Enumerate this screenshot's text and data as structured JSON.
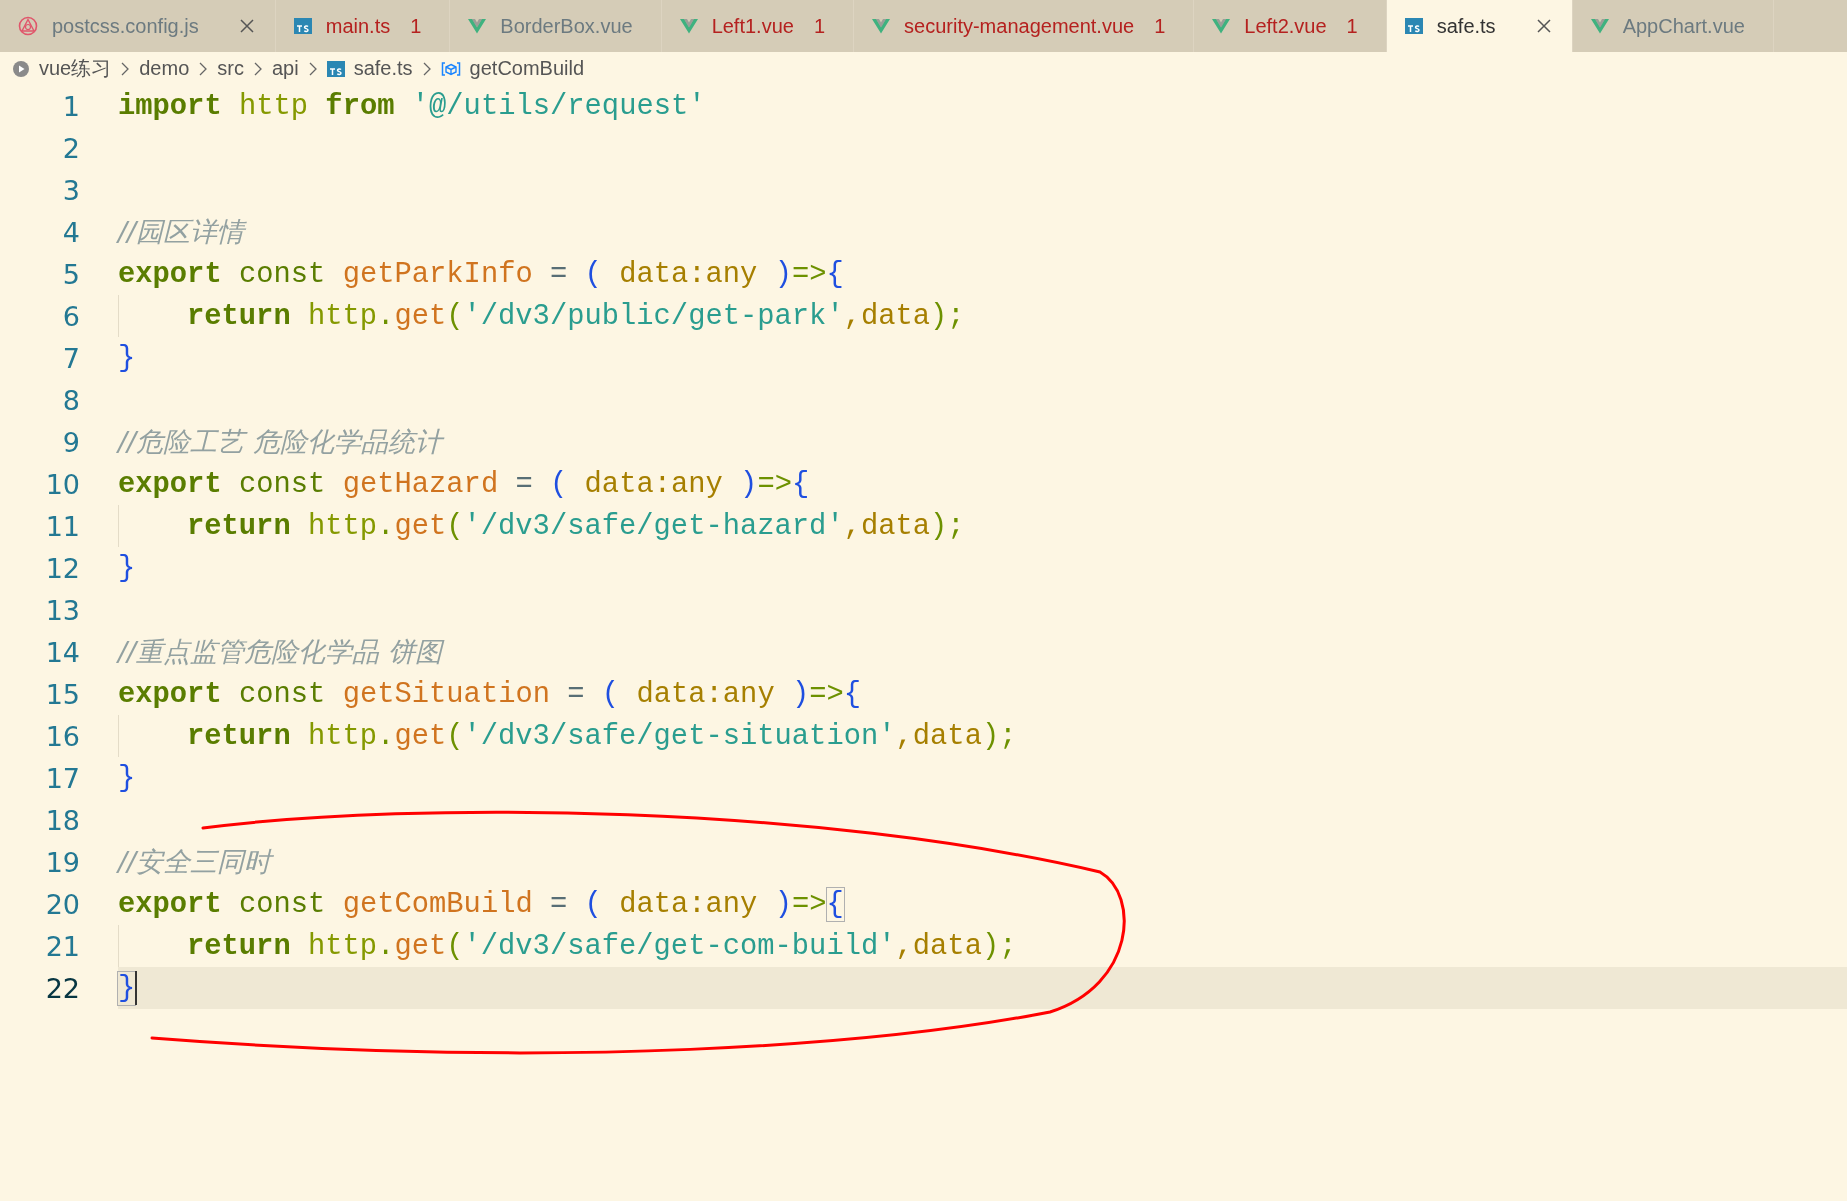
{
  "tabs": [
    {
      "label": "postcss.config.js",
      "kind": "postcss",
      "error": false,
      "selected": false,
      "closable": true
    },
    {
      "label": "main.ts",
      "kind": "ts",
      "error": true,
      "problems": "1",
      "selected": false,
      "closable": false
    },
    {
      "label": "BorderBox.vue",
      "kind": "vue",
      "error": false,
      "selected": false,
      "closable": false
    },
    {
      "label": "Left1.vue",
      "kind": "vue",
      "error": true,
      "problems": "1",
      "selected": false,
      "closable": false
    },
    {
      "label": "security-management.vue",
      "kind": "vue",
      "error": true,
      "problems": "1",
      "selected": false,
      "closable": false
    },
    {
      "label": "Left2.vue",
      "kind": "vue",
      "error": true,
      "problems": "1",
      "selected": false,
      "closable": false
    },
    {
      "label": "safe.ts",
      "kind": "ts",
      "error": false,
      "selected": true,
      "closable": true
    },
    {
      "label": "AppChart.vue",
      "kind": "vue",
      "error": false,
      "selected": false,
      "closable": false
    }
  ],
  "breadcrumb": [
    {
      "label": "vue练习",
      "kind": "folder"
    },
    {
      "label": "demo",
      "kind": "folder-plain"
    },
    {
      "label": "src",
      "kind": "folder-plain"
    },
    {
      "label": "api",
      "kind": "folder-plain"
    },
    {
      "label": "safe.ts",
      "kind": "ts"
    },
    {
      "label": "getComBuild",
      "kind": "symbol"
    }
  ],
  "editor": {
    "lines": [
      {
        "number": "1",
        "current": false,
        "indented": false,
        "tokens": [
          {
            "kind": "keyword",
            "text": "import"
          },
          {
            "kind": "variable",
            "text": " http"
          },
          {
            "kind": "keyword",
            "text": " from"
          },
          {
            "kind": "string",
            "text": " '@/utils/request'"
          }
        ]
      },
      {
        "number": "2",
        "current": false,
        "indented": false
      },
      {
        "number": "3",
        "current": false,
        "indented": false
      },
      {
        "number": "4",
        "current": false,
        "indented": false,
        "tokens": [
          {
            "kind": "comment",
            "text": "//园区详情"
          }
        ]
      },
      {
        "number": "5",
        "current": false,
        "indented": false,
        "tokens": [
          {
            "kind": "keyword",
            "text": "export"
          },
          {
            "kind": "storage",
            "text": " const"
          },
          {
            "kind": "function",
            "text": " getParkInfo"
          },
          {
            "kind": "plain",
            "text": " ="
          },
          {
            "kind": "bracket",
            "text": " ("
          },
          {
            "kind": "param",
            "text": " data:any"
          },
          {
            "kind": "bracket",
            "text": " )"
          },
          {
            "kind": "punct",
            "text": "=>"
          },
          {
            "kind": "bracket",
            "text": "{"
          }
        ]
      },
      {
        "number": "6",
        "current": false,
        "indented": true,
        "tokens": [
          {
            "kind": "keyword",
            "text": "return"
          },
          {
            "kind": "variable",
            "text": " http"
          },
          {
            "kind": "punct",
            "text": "."
          },
          {
            "kind": "function",
            "text": "get"
          },
          {
            "kind": "punct",
            "text": "("
          },
          {
            "kind": "string",
            "text": "'/dv3/public/get-park'"
          },
          {
            "kind": "param",
            "text": ",data"
          },
          {
            "kind": "punct",
            "text": ");"
          }
        ]
      },
      {
        "number": "7",
        "current": false,
        "indented": false,
        "tokens": [
          {
            "kind": "bracket",
            "text": "}"
          }
        ]
      },
      {
        "number": "8",
        "current": false,
        "indented": false
      },
      {
        "number": "9",
        "current": false,
        "indented": false,
        "tokens": [
          {
            "kind": "comment",
            "text": "//危险工艺 危险化学品统计"
          }
        ]
      },
      {
        "number": "10",
        "current": false,
        "indented": false,
        "tokens": [
          {
            "kind": "keyword",
            "text": "export"
          },
          {
            "kind": "storage",
            "text": " const"
          },
          {
            "kind": "function",
            "text": " getHazard"
          },
          {
            "kind": "plain",
            "text": " ="
          },
          {
            "kind": "bracket",
            "text": " ("
          },
          {
            "kind": "param",
            "text": " data:any"
          },
          {
            "kind": "bracket",
            "text": " )"
          },
          {
            "kind": "punct",
            "text": "=>"
          },
          {
            "kind": "bracket",
            "text": "{"
          }
        ]
      },
      {
        "number": "11",
        "current": false,
        "indented": true,
        "tokens": [
          {
            "kind": "keyword",
            "text": "return"
          },
          {
            "kind": "variable",
            "text": " http"
          },
          {
            "kind": "punct",
            "text": "."
          },
          {
            "kind": "function",
            "text": "get"
          },
          {
            "kind": "punct",
            "text": "("
          },
          {
            "kind": "string",
            "text": "'/dv3/safe/get-hazard'"
          },
          {
            "kind": "param",
            "text": ",data"
          },
          {
            "kind": "punct",
            "text": ");"
          }
        ]
      },
      {
        "number": "12",
        "current": false,
        "indented": false,
        "tokens": [
          {
            "kind": "bracket",
            "text": "}"
          }
        ]
      },
      {
        "number": "13",
        "current": false,
        "indented": false
      },
      {
        "number": "14",
        "current": false,
        "indented": false,
        "tokens": [
          {
            "kind": "comment",
            "text": "//重点监管危险化学品 饼图"
          }
        ]
      },
      {
        "number": "15",
        "current": false,
        "indented": false,
        "tokens": [
          {
            "kind": "keyword",
            "text": "export"
          },
          {
            "kind": "storage",
            "text": " const"
          },
          {
            "kind": "function",
            "text": " getSituation"
          },
          {
            "kind": "plain",
            "text": " ="
          },
          {
            "kind": "bracket",
            "text": " ("
          },
          {
            "kind": "param",
            "text": " data:any"
          },
          {
            "kind": "bracket",
            "text": " )"
          },
          {
            "kind": "punct",
            "text": "=>"
          },
          {
            "kind": "bracket",
            "text": "{"
          }
        ]
      },
      {
        "number": "16",
        "current": false,
        "indented": true,
        "tokens": [
          {
            "kind": "keyword",
            "text": "return"
          },
          {
            "kind": "variable",
            "text": " http"
          },
          {
            "kind": "punct",
            "text": "."
          },
          {
            "kind": "function",
            "text": "get"
          },
          {
            "kind": "punct",
            "text": "("
          },
          {
            "kind": "string",
            "text": "'/dv3/safe/get-situation'"
          },
          {
            "kind": "param",
            "text": ",data"
          },
          {
            "kind": "punct",
            "text": ");"
          }
        ]
      },
      {
        "number": "17",
        "current": false,
        "indented": false,
        "tokens": [
          {
            "kind": "bracket",
            "text": "}"
          }
        ]
      },
      {
        "number": "18",
        "current": false,
        "indented": false
      },
      {
        "number": "19",
        "current": false,
        "indented": false,
        "tokens": [
          {
            "kind": "comment",
            "text": "//安全三同时"
          }
        ]
      },
      {
        "number": "20",
        "current": false,
        "indented": false,
        "tokens": [
          {
            "kind": "keyword",
            "text": "export"
          },
          {
            "kind": "storage",
            "text": " const"
          },
          {
            "kind": "function",
            "text": " getComBuild"
          },
          {
            "kind": "plain",
            "text": " ="
          },
          {
            "kind": "bracket",
            "text": " ("
          },
          {
            "kind": "param",
            "text": " data:any"
          },
          {
            "kind": "bracket",
            "text": " )"
          },
          {
            "kind": "punct",
            "text": "=>"
          },
          {
            "kind": "bracket-match",
            "text": "{"
          }
        ]
      },
      {
        "number": "21",
        "current": false,
        "indented": true,
        "tokens": [
          {
            "kind": "keyword",
            "text": "return"
          },
          {
            "kind": "variable",
            "text": " http"
          },
          {
            "kind": "punct",
            "text": "."
          },
          {
            "kind": "function",
            "text": "get"
          },
          {
            "kind": "punct",
            "text": "("
          },
          {
            "kind": "string",
            "text": "'/dv3/safe/get-com-build'"
          },
          {
            "kind": "param",
            "text": ",data"
          },
          {
            "kind": "punct",
            "text": ");"
          }
        ]
      },
      {
        "number": "22",
        "current": true,
        "indented": false,
        "tokens": [
          {
            "kind": "bracket-match",
            "text": "}"
          }
        ]
      }
    ]
  },
  "annotation": {
    "kind": "freehand-loop"
  }
}
